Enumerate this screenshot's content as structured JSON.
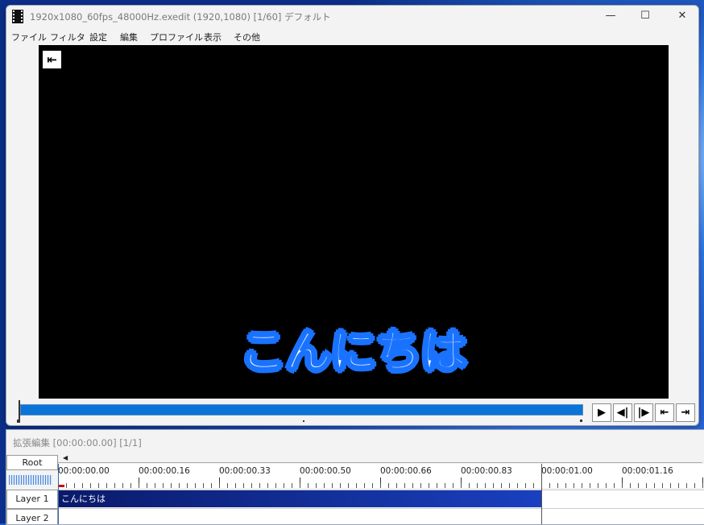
{
  "window": {
    "title": "1920x1080_60fps_48000Hz.exedit (1920,1080)  [1/60]  デフォルト",
    "controls": {
      "minimize": "—",
      "maximize": "☐",
      "close": "✕"
    }
  },
  "menu": [
    "ファイル",
    "フィルタ",
    "設定",
    "編集",
    "プロファイル",
    "表示",
    "その他"
  ],
  "preview": {
    "subtitle_text": "こんにちは",
    "home_button_glyph": "⇤"
  },
  "playback": {
    "progress_fraction": 1.0,
    "buttons": [
      {
        "name": "play-button",
        "glyph": "▶"
      },
      {
        "name": "prev-frame-button",
        "glyph": "◀|"
      },
      {
        "name": "next-frame-button",
        "glyph": "|▶"
      },
      {
        "name": "go-start-button",
        "glyph": "⇤"
      },
      {
        "name": "go-end-button",
        "glyph": "⇥"
      }
    ]
  },
  "timeline": {
    "title": "拡張編集 [00:00:00.00] [1/1]",
    "root_label": "Root",
    "ruler_labels": [
      "00:00:00.00",
      "00:00:00.16",
      "00:00:00.33",
      "00:00:00.50",
      "00:00:00.66",
      "00:00:00.83",
      "00:00:01.00",
      "00:00:01.16"
    ],
    "layers": [
      "Layer 1",
      "Layer 2"
    ],
    "clip_text": "こんにちは"
  },
  "colors": {
    "accent": "#0a74d8",
    "subtitle_outline": "#1a73ff",
    "clip_start": "#0a1a6a",
    "clip_end": "#1a40c0"
  }
}
